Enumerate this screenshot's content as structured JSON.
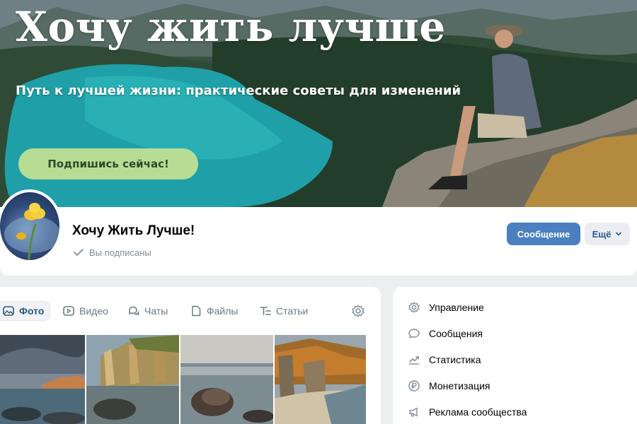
{
  "cover": {
    "title": "Хочу жить лучше",
    "subtitle": "Путь к лучшей жизни: практические советы для изменений",
    "cta_label": "Подпишись сейчас!"
  },
  "group": {
    "name": "Хочу Жить Лучше!",
    "subscription_status": "Вы подписаны",
    "message_button": "Сообщение",
    "more_button": "Ещё"
  },
  "media_tabs": [
    {
      "label": "Фото",
      "icon": "photo-icon",
      "active": true
    },
    {
      "label": "Видео",
      "icon": "video-icon",
      "active": false
    },
    {
      "label": "Чаты",
      "icon": "chats-icon",
      "active": false
    },
    {
      "label": "Файлы",
      "icon": "file-icon",
      "active": false
    },
    {
      "label": "Статьи",
      "icon": "articles-icon",
      "active": false
    }
  ],
  "menu": {
    "items": [
      {
        "label": "Управление",
        "icon": "gear-icon"
      },
      {
        "label": "Сообщения",
        "icon": "message-icon"
      },
      {
        "label": "Статистика",
        "icon": "stats-icon"
      },
      {
        "label": "Монетизация",
        "icon": "ruble-icon"
      },
      {
        "label": "Реклама сообщества",
        "icon": "megaphone-icon"
      }
    ]
  },
  "colors": {
    "accent": "#4a7fc1",
    "cta": "#b7dd94",
    "background": "#edeef0"
  }
}
